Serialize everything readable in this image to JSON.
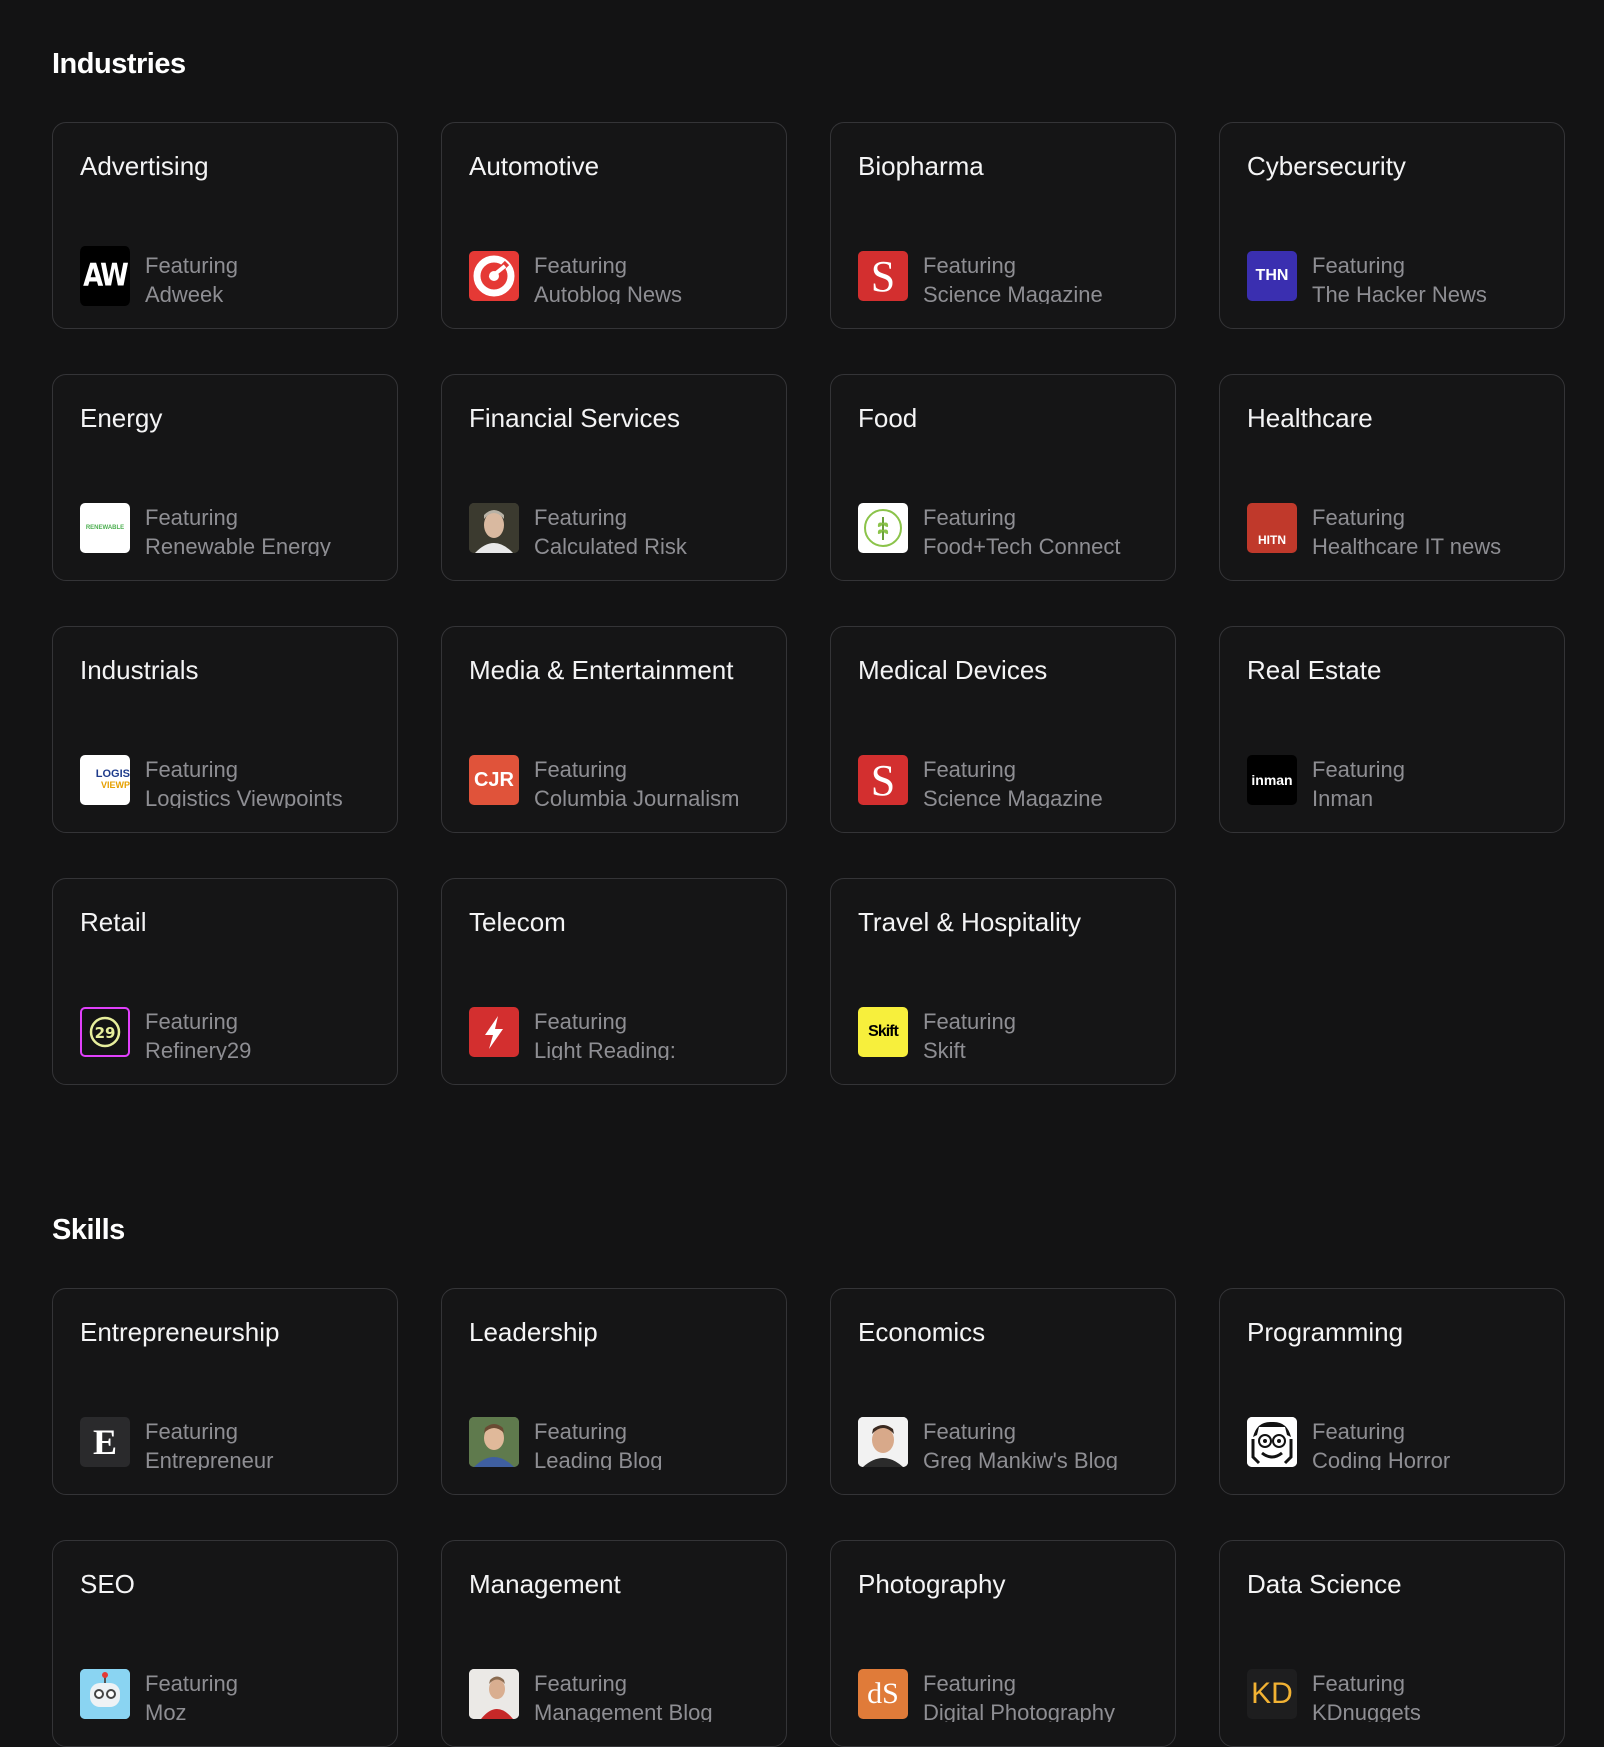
{
  "industries": {
    "title": "Industries",
    "cards": [
      {
        "title": "Advertising",
        "featuring": "Featuring",
        "source": "Adweek",
        "logo_text": "AW",
        "icon": "adweek-logo-icon"
      },
      {
        "title": "Automotive",
        "featuring": "Featuring",
        "source": "Autoblog News",
        "logo_text": "",
        "icon": "autoblog-logo-icon"
      },
      {
        "title": "Biopharma",
        "featuring": "Featuring",
        "source": "Science Magazine",
        "logo_text": "S",
        "icon": "science-magazine-logo-icon"
      },
      {
        "title": "Cybersecurity",
        "featuring": "Featuring",
        "source": "The Hacker News",
        "logo_text": "THN",
        "icon": "hacker-news-logo-icon"
      },
      {
        "title": "Energy",
        "featuring": "Featuring",
        "source": "Renewable Energy",
        "logo_text": "RENEWABLE",
        "icon": "renewable-energy-logo-icon"
      },
      {
        "title": "Financial Services",
        "featuring": "Featuring",
        "source": "Calculated Risk",
        "logo_text": "",
        "icon": "calculated-risk-avatar-icon"
      },
      {
        "title": "Food",
        "featuring": "Featuring",
        "source": "Food+Tech Connect",
        "logo_text": "",
        "icon": "food-tech-connect-logo-icon"
      },
      {
        "title": "Healthcare",
        "featuring": "Featuring",
        "source": "Healthcare IT news",
        "logo_text": "HITN",
        "icon": "healthcare-it-news-logo-icon"
      },
      {
        "title": "Industrials",
        "featuring": "Featuring",
        "source": "Logistics Viewpoints",
        "logo_text": "LOGIS",
        "logo_text2": "VIEWP",
        "icon": "logistics-viewpoints-logo-icon"
      },
      {
        "title": "Media & Entertainment",
        "featuring": "Featuring",
        "source": "Columbia Journalism",
        "logo_text": "CJR",
        "icon": "cjr-logo-icon"
      },
      {
        "title": "Medical Devices",
        "featuring": "Featuring",
        "source": "Science Magazine",
        "logo_text": "S",
        "icon": "science-magazine-logo-icon"
      },
      {
        "title": "Real Estate",
        "featuring": "Featuring",
        "source": "Inman",
        "logo_text": "inman",
        "icon": "inman-logo-icon"
      },
      {
        "title": "Retail",
        "featuring": "Featuring",
        "source": "Refinery29",
        "logo_text": "29",
        "icon": "refinery29-logo-icon"
      },
      {
        "title": "Telecom",
        "featuring": "Featuring",
        "source": "Light Reading:",
        "logo_text": "",
        "icon": "light-reading-logo-icon"
      },
      {
        "title": "Travel & Hospitality",
        "featuring": "Featuring",
        "source": "Skift",
        "logo_text": "Skift",
        "icon": "skift-logo-icon"
      }
    ]
  },
  "skills": {
    "title": "Skills",
    "cards": [
      {
        "title": "Entrepreneurship",
        "featuring": "Featuring",
        "source": "Entrepreneur",
        "logo_text": "E",
        "icon": "entrepreneur-logo-icon"
      },
      {
        "title": "Leadership",
        "featuring": "Featuring",
        "source": "Leading Blog",
        "logo_text": "",
        "icon": "leading-blog-avatar-icon"
      },
      {
        "title": "Economics",
        "featuring": "Featuring",
        "source": "Greg Mankiw's Blog",
        "logo_text": "",
        "icon": "mankiw-avatar-icon"
      },
      {
        "title": "Programming",
        "featuring": "Featuring",
        "source": "Coding Horror",
        "logo_text": "",
        "icon": "coding-horror-logo-icon"
      },
      {
        "title": "SEO",
        "featuring": "Featuring",
        "source": "Moz",
        "logo_text": "",
        "icon": "moz-logo-icon"
      },
      {
        "title": "Management",
        "featuring": "Featuring",
        "source": "Management Blog",
        "logo_text": "",
        "icon": "management-blog-avatar-icon"
      },
      {
        "title": "Photography",
        "featuring": "Featuring",
        "source": "Digital Photography",
        "logo_text": "dS",
        "icon": "digital-photography-logo-icon"
      },
      {
        "title": "Data Science",
        "featuring": "Featuring",
        "source": "KDnuggets",
        "logo_text": "KD",
        "icon": "kdnuggets-logo-icon"
      }
    ]
  }
}
